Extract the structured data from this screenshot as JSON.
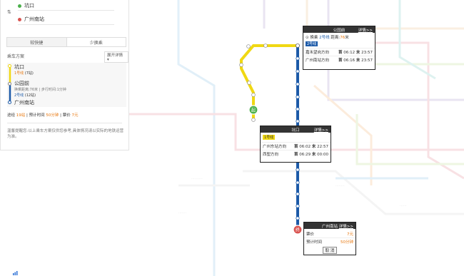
{
  "search": {
    "origin": "坑口",
    "destination": "广州南站",
    "swap_icon": "⇅"
  },
  "tabs": [
    {
      "label": "较快捷"
    },
    {
      "label": "少换乘"
    }
  ],
  "plan": {
    "title": "乘车方案",
    "expand_label": "展开详情",
    "start_station": "坑口",
    "line1": "1号线",
    "line1_stops": "(7站)",
    "transfer_station": "公园前",
    "transfer_info": "换乘距离:76米 | 步行时间:1分钟",
    "line2": "2号线",
    "line2_stops": "(12站)",
    "end_station": "广州南站",
    "summary": {
      "label_stations": "途经",
      "stations": "19站",
      "label_time": "预计时间",
      "time": "50分钟",
      "label_fare": "票价",
      "fare": "7元"
    },
    "note": "温馨提醒您:以上乘车方案仅供您参考,具体情况请以实际的地铁运营为准。"
  },
  "popups": {
    "transfer": {
      "title": "公园前",
      "more": "详情>>",
      "walk_prefix": "换乘",
      "walk_line": "2号线",
      "walk_mid": "距离:",
      "walk_distance": "76",
      "walk_unit": "米",
      "line": "2号线",
      "rows": [
        {
          "dir": "嘉禾望岗方向",
          "first": "06:12",
          "last": "23:57"
        },
        {
          "dir": "广州南站方向",
          "first": "06:16",
          "last": "23:57"
        }
      ],
      "first_label": "首",
      "last_label": "末"
    },
    "start": {
      "title": "坑口",
      "more": "详情>>",
      "line": "1号线",
      "rows": [
        {
          "dir": "广州东站方向",
          "first": "06:02",
          "last": "22:57"
        },
        {
          "dir": "西塱方向",
          "first": "06:29",
          "last": "00:00"
        }
      ],
      "first_label": "首",
      "last_label": "末"
    },
    "end": {
      "title": "广州南站",
      "more": "详情>>",
      "fare_label": "票价",
      "fare": "7元",
      "time_label": "预计时间",
      "time": "50分钟",
      "close_label": "取 消"
    }
  },
  "markers": {
    "start_label": "起",
    "end_label": "终"
  },
  "colors": {
    "line1": "#f0d813",
    "line2": "#1c5aa8",
    "start_marker": "#4bb04b",
    "end_marker": "#d9534f",
    "accent": "#e8760c"
  }
}
